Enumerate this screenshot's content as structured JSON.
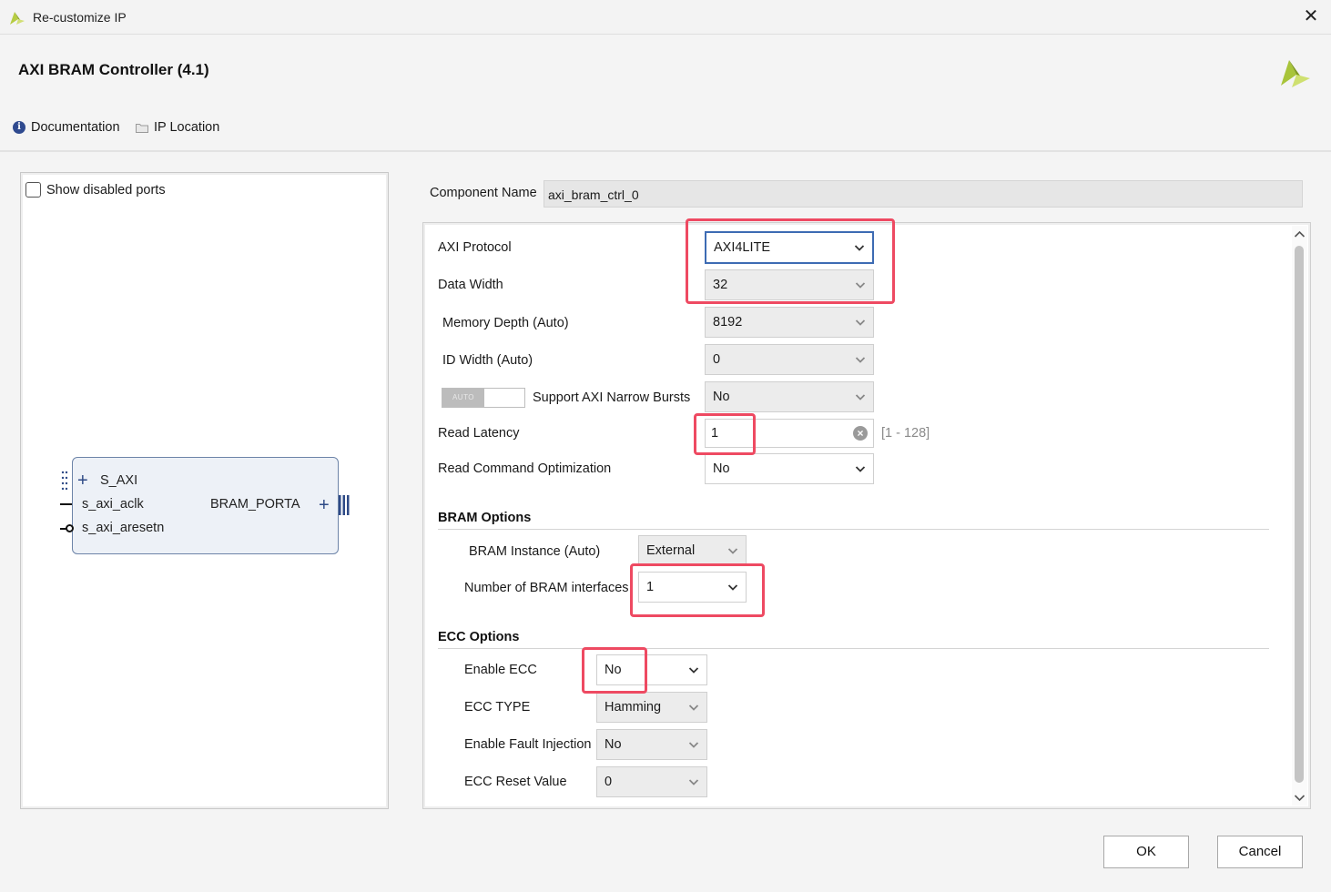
{
  "window": {
    "title": "Re-customize IP",
    "close_glyph": "✕"
  },
  "header": {
    "ip_title": "AXI BRAM Controller (4.1)",
    "links": [
      {
        "label": "Documentation",
        "icon": "info-icon"
      },
      {
        "label": "IP Location",
        "icon": "folder-icon"
      }
    ]
  },
  "left_panel": {
    "show_disabled_ports": {
      "label": "Show disabled ports",
      "checked": false
    },
    "block": {
      "ports_left": [
        "S_AXI",
        "s_axi_aclk",
        "s_axi_aresetn"
      ],
      "port_right": "BRAM_PORTA"
    }
  },
  "component": {
    "label": "Component Name",
    "value": "axi_bram_ctrl_0"
  },
  "params": {
    "axi_protocol": {
      "label": "AXI Protocol",
      "value": "AXI4LITE"
    },
    "data_width": {
      "label": "Data Width",
      "value": "32"
    },
    "memory_depth": {
      "label": "Memory Depth (Auto)",
      "value": "8192"
    },
    "id_width": {
      "label": "ID Width (Auto)",
      "value": "0"
    },
    "narrow_bursts": {
      "label": "Support AXI Narrow Bursts",
      "value": "No",
      "toggle_text": "AUTO"
    },
    "read_latency": {
      "label": "Read Latency",
      "value": "1",
      "range": "[1 - 128]"
    },
    "read_cmd_opt": {
      "label": "Read Command Optimization",
      "value": "No"
    }
  },
  "bram_options": {
    "title": "BRAM Options",
    "instance": {
      "label": "BRAM Instance (Auto)",
      "value": "External"
    },
    "num_interfaces": {
      "label": "Number of BRAM interfaces",
      "value": "1"
    }
  },
  "ecc_options": {
    "title": "ECC Options",
    "enable_ecc": {
      "label": "Enable ECC",
      "value": "No"
    },
    "ecc_type": {
      "label": "ECC TYPE",
      "value": "Hamming"
    },
    "fault_injection": {
      "label": "Enable Fault Injection",
      "value": "No"
    },
    "reset_value": {
      "label": "ECC Reset Value",
      "value": "0"
    }
  },
  "buttons": {
    "ok": "OK",
    "cancel": "Cancel"
  },
  "colors": {
    "highlight": "#ee4a62",
    "focus": "#3d6bb3",
    "block_border": "#6d84a8",
    "logo": "#a8c43a"
  }
}
